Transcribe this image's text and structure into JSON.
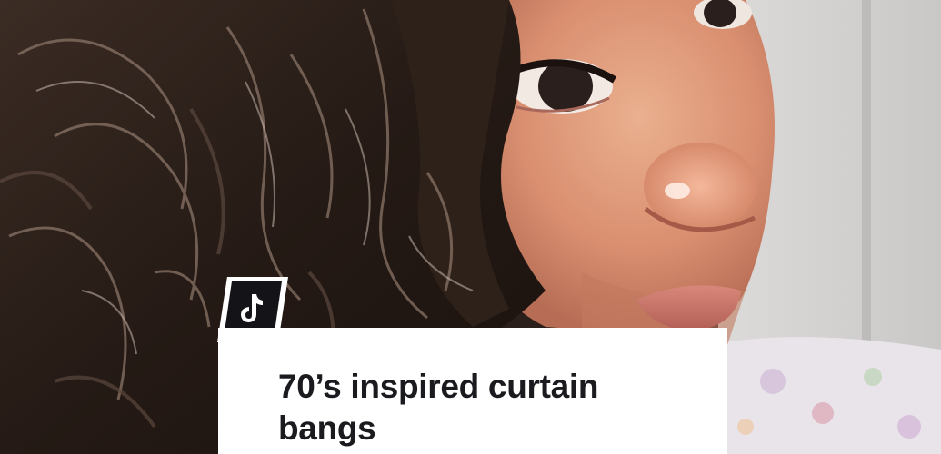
{
  "caption": {
    "text": "70’s inspired curtain bangs"
  },
  "logo": {
    "icon": "tiktok-logo-icon"
  },
  "photo": {
    "subject": "close-up portrait with curled dark hair"
  },
  "colors": {
    "card_background": "#ffffff",
    "caption_text": "#1b1b1f",
    "logo_background": "#141418"
  }
}
